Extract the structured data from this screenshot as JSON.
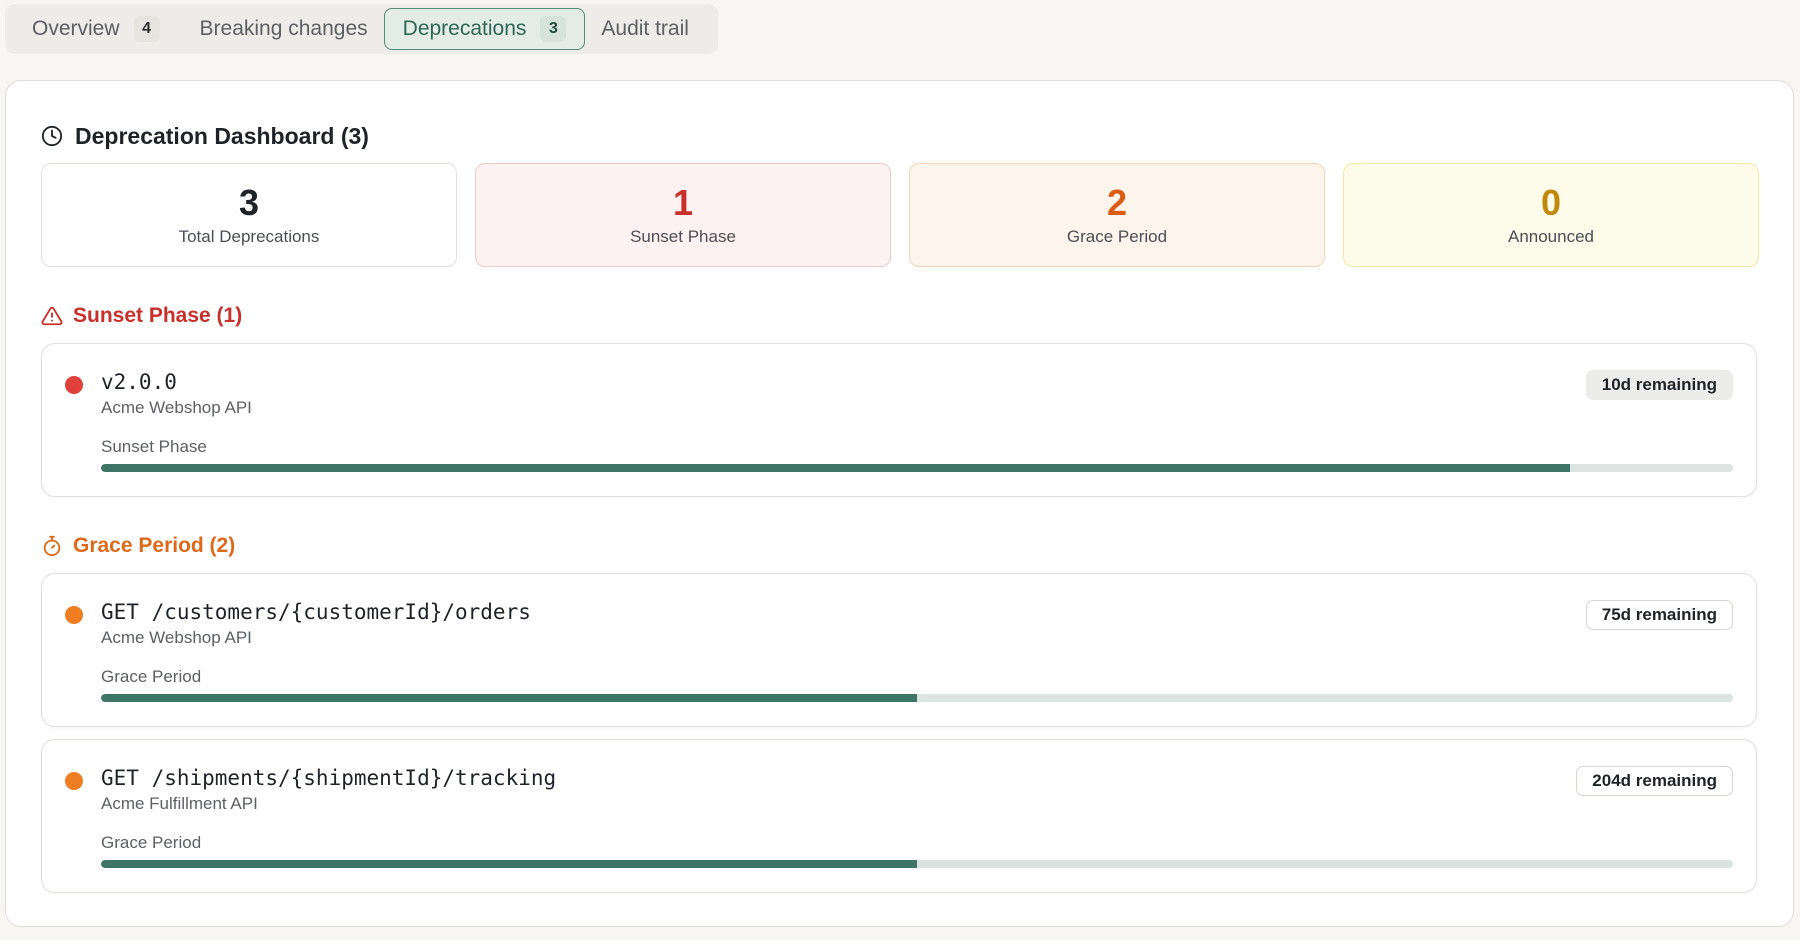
{
  "tabs": [
    {
      "label": "Overview",
      "count": "4"
    },
    {
      "label": "Breaking changes"
    },
    {
      "label": "Deprecations",
      "count": "3",
      "active": true
    },
    {
      "label": "Audit trail"
    }
  ],
  "dashboard": {
    "title": "Deprecation Dashboard (3)",
    "icon": "clock-icon",
    "stats": [
      {
        "value": "3",
        "label": "Total Deprecations",
        "color": "#1f2328"
      },
      {
        "value": "1",
        "label": "Sunset Phase",
        "color": "#c9302c"
      },
      {
        "value": "2",
        "label": "Grace Period",
        "color": "#dd5a14"
      },
      {
        "value": "0",
        "label": "Announced",
        "color": "#c1890a"
      }
    ]
  },
  "sections": {
    "sunset": {
      "title": "Sunset Phase (1)",
      "icon": "warning-triangle-icon",
      "color": "#c9302c",
      "items": [
        {
          "path": "v2.0.0",
          "api": "Acme Webshop API",
          "phase": "Sunset Phase",
          "remaining": "10d remaining",
          "progress": 0.9,
          "dot_color": "#e0413c"
        }
      ]
    },
    "grace": {
      "title": "Grace Period (2)",
      "icon": "stopwatch-icon",
      "color": "#dd6a1a",
      "items": [
        {
          "path": "GET /customers/{customerId}/orders",
          "api": "Acme Webshop API",
          "phase": "Grace Period",
          "remaining": "75d remaining",
          "progress": 0.5,
          "dot_color": "#ef7d22"
        },
        {
          "path": "GET /shipments/{shipmentId}/tracking",
          "api": "Acme Fulfillment API",
          "phase": "Grace Period",
          "remaining": "204d remaining",
          "progress": 0.5,
          "dot_color": "#ef7d22"
        }
      ]
    }
  },
  "colors": {
    "accent": "#3e7566",
    "track": "#dbe4e0"
  }
}
